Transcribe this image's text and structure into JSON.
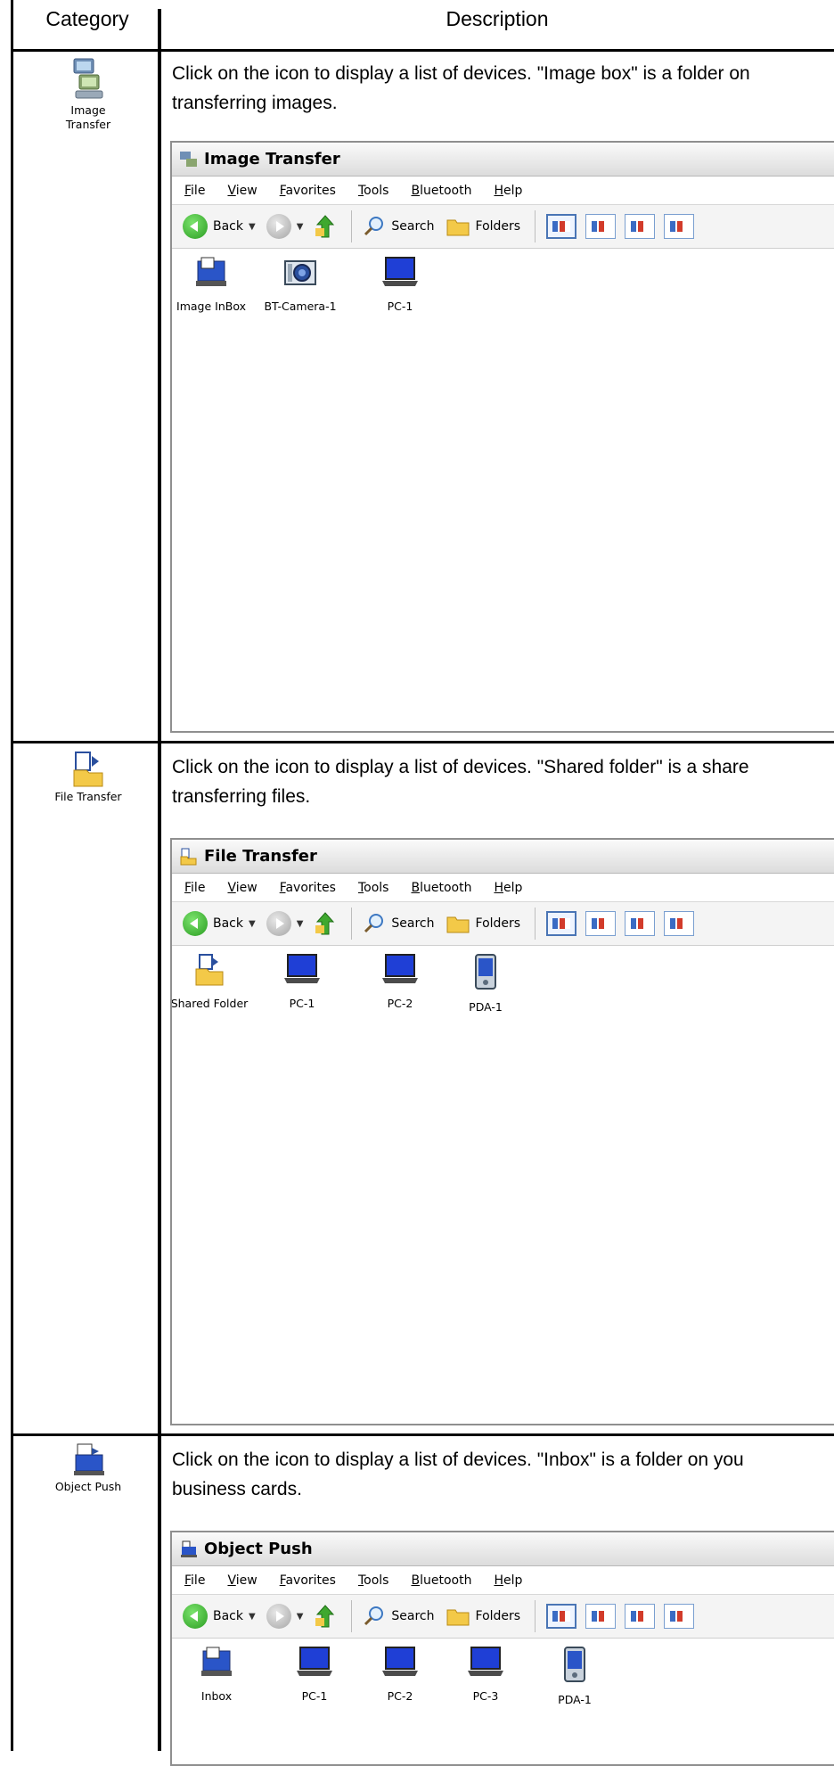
{
  "header": {
    "category": "Category",
    "description": "Description"
  },
  "sections": [
    {
      "category_label": "Image Transfer",
      "category_icon": "image-transfer-icon",
      "description": "Click on the icon to display a list of devices. \"Image box\" is a folder on",
      "description_line2": "transferring images.",
      "window": {
        "title": "Image Transfer",
        "menu": [
          "File",
          "View",
          "Favorites",
          "Tools",
          "Bluetooth",
          "Help"
        ],
        "toolbar": {
          "back": "Back",
          "search": "Search",
          "folders": "Folders"
        },
        "items": [
          {
            "label": "Image InBox",
            "icon": "image-inbox-icon"
          },
          {
            "label": "BT-Camera-1",
            "icon": "camera-icon"
          },
          {
            "label": "PC-1",
            "icon": "laptop-icon"
          }
        ]
      }
    },
    {
      "category_label": "File Transfer",
      "category_icon": "file-transfer-icon",
      "description": "Click on the icon to display a list of devices. \"Shared folder\" is a share",
      "description_line2": "transferring files.",
      "window": {
        "title": "File Transfer",
        "menu": [
          "File",
          "View",
          "Favorites",
          "Tools",
          "Bluetooth",
          "Help"
        ],
        "toolbar": {
          "back": "Back",
          "search": "Search",
          "folders": "Folders"
        },
        "items": [
          {
            "label": "Shared Folder",
            "icon": "shared-folder-icon"
          },
          {
            "label": "PC-1",
            "icon": "laptop-icon"
          },
          {
            "label": "PC-2",
            "icon": "laptop-icon"
          },
          {
            "label": "PDA-1",
            "icon": "pda-icon"
          }
        ]
      }
    },
    {
      "category_label": "Object Push",
      "category_icon": "object-push-icon",
      "description": "Click on the icon to display a list of devices. \"Inbox\" is a folder on you",
      "description_line2": "business cards.",
      "window": {
        "title": "Object Push",
        "menu": [
          "File",
          "View",
          "Favorites",
          "Tools",
          "Bluetooth",
          "Help"
        ],
        "toolbar": {
          "back": "Back",
          "search": "Search",
          "folders": "Folders"
        },
        "items": [
          {
            "label": "Inbox",
            "icon": "inbox-icon"
          },
          {
            "label": "PC-1",
            "icon": "laptop-icon"
          },
          {
            "label": "PC-2",
            "icon": "laptop-icon"
          },
          {
            "label": "PC-3",
            "icon": "laptop-icon"
          },
          {
            "label": "PDA-1",
            "icon": "pda-icon"
          }
        ]
      }
    }
  ]
}
